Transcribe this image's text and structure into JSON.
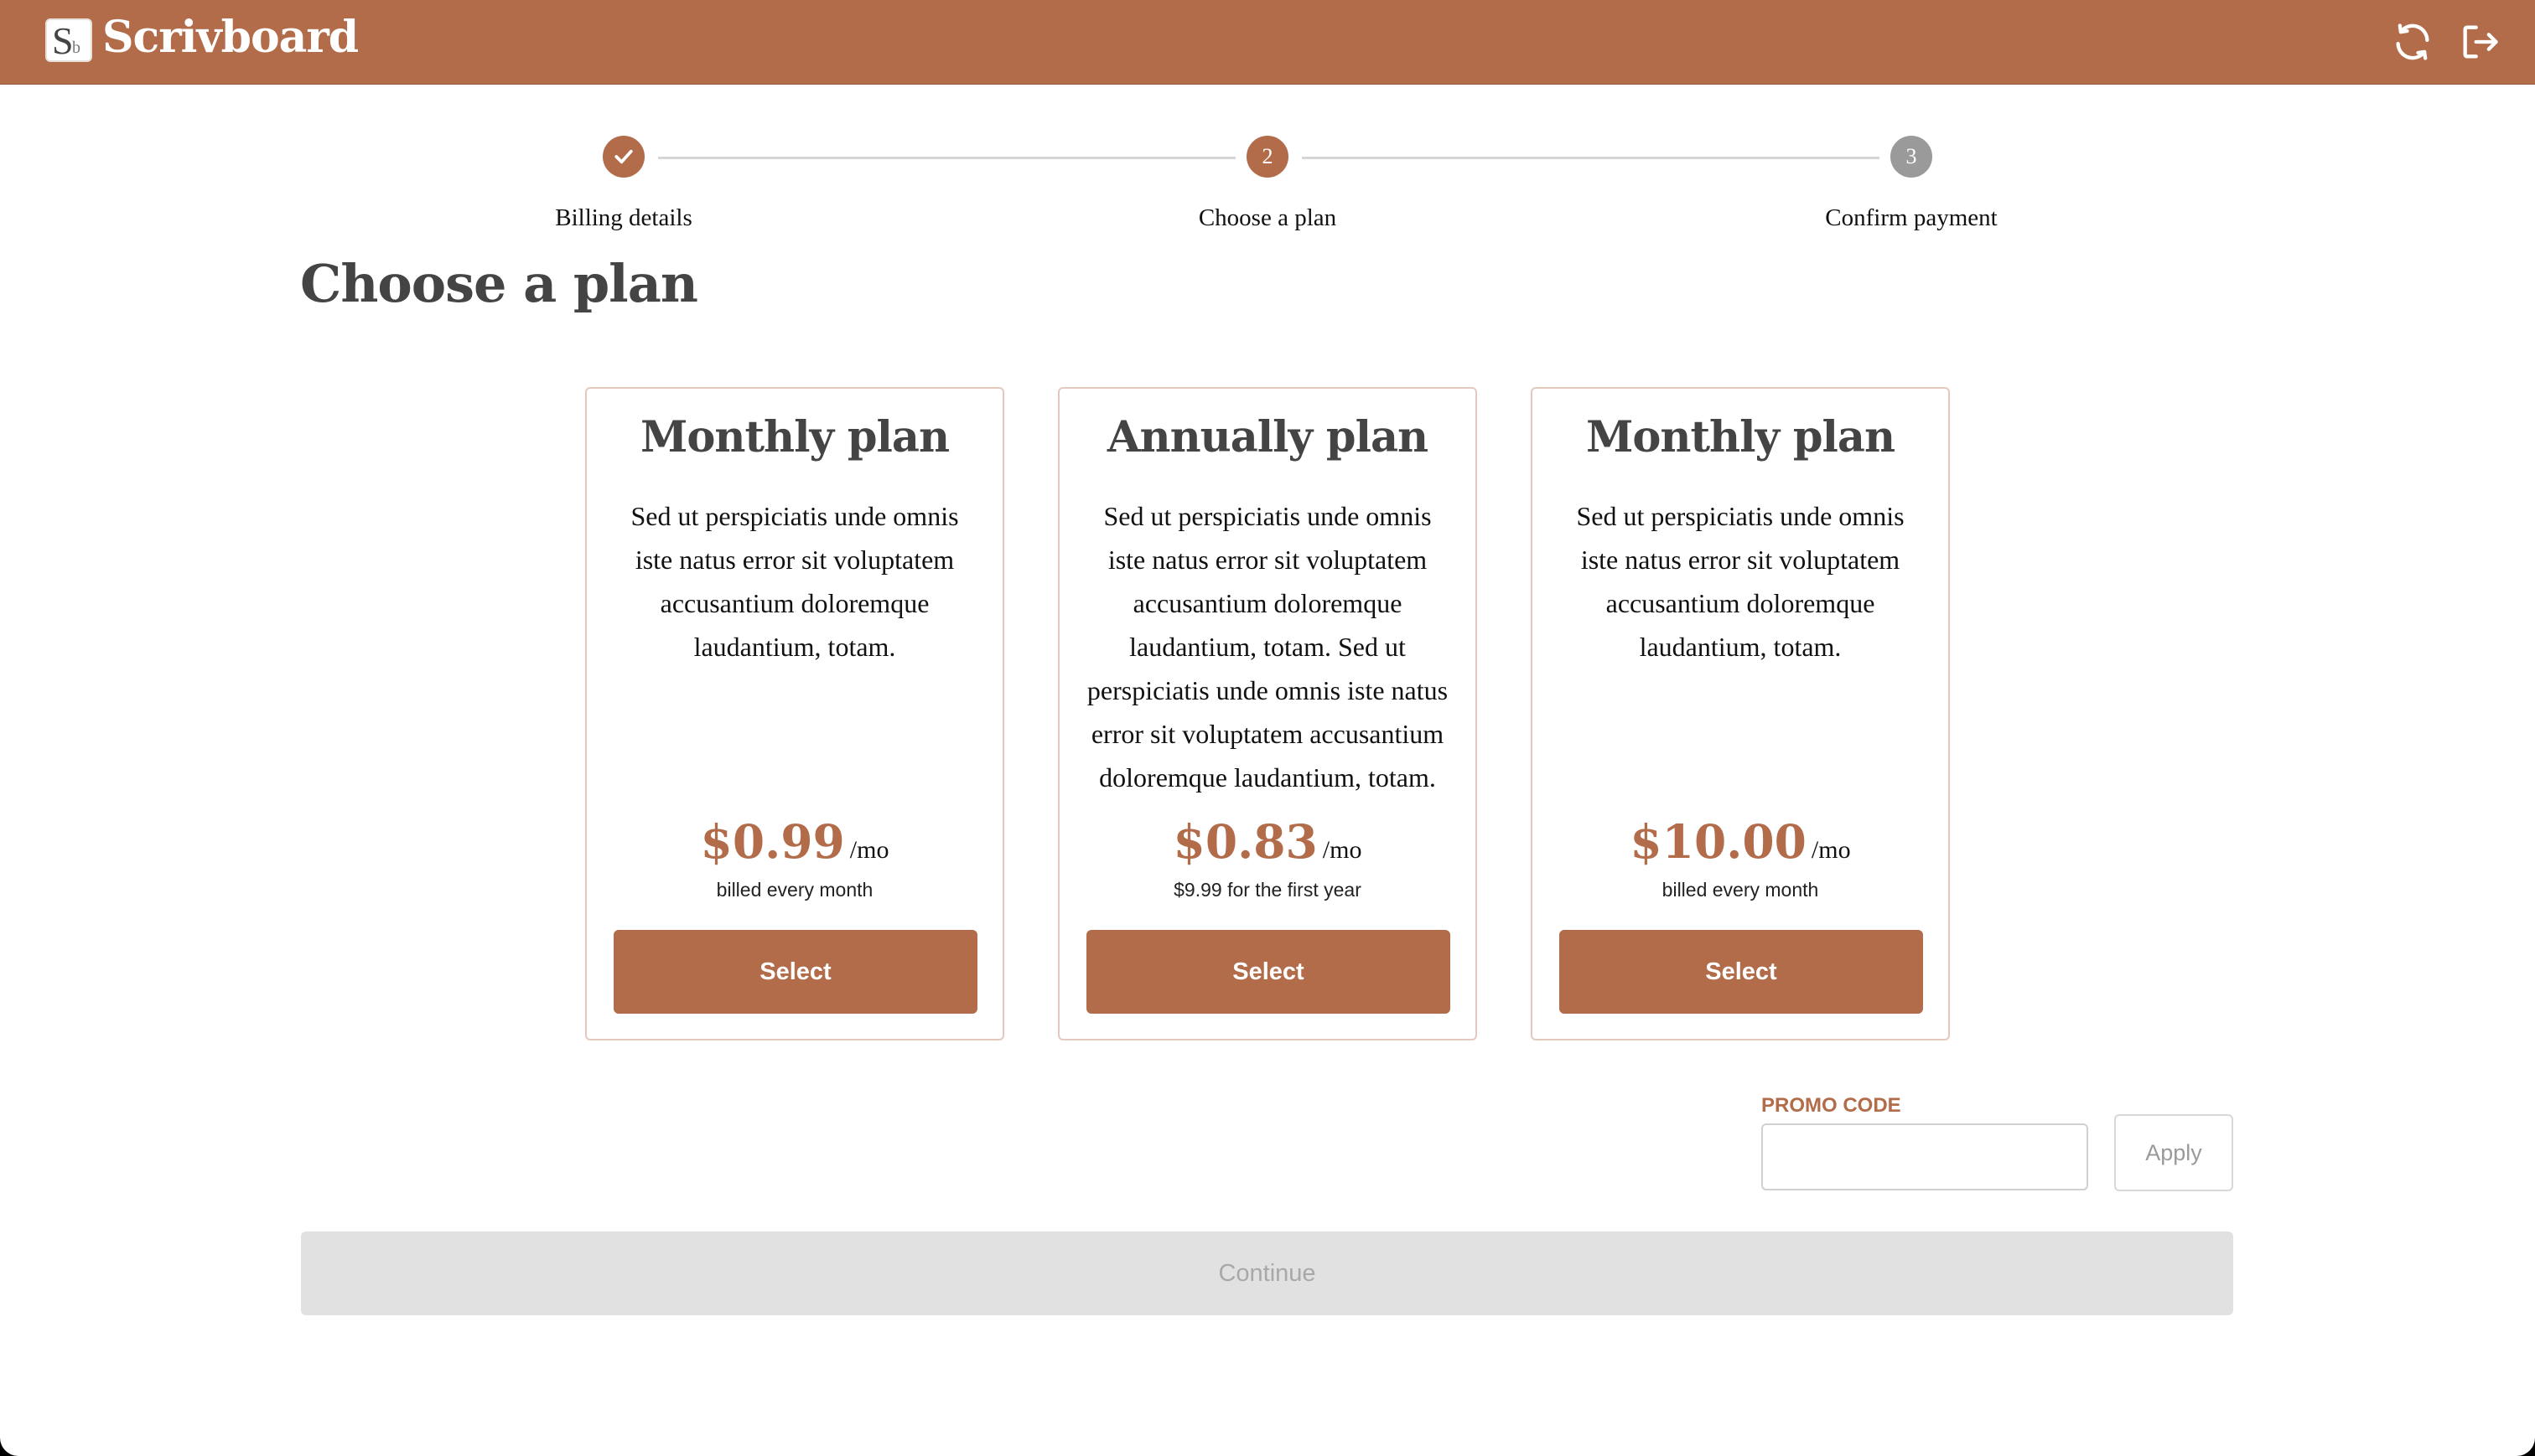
{
  "header": {
    "app_name": "Scrivboard",
    "logo_letter_main": "S",
    "logo_letter_sub": "b",
    "refresh_icon": "refresh-icon",
    "logout_icon": "logout-icon",
    "background": "#b26c4a"
  },
  "stepper": {
    "steps": [
      {
        "label": "Billing details",
        "number": "1",
        "state": "completed"
      },
      {
        "label": "Choose a plan",
        "number": "2",
        "state": "active"
      },
      {
        "label": "Confirm payment",
        "number": "3",
        "state": "pending"
      }
    ],
    "active_color": "#b26c4a",
    "pending_color": "#9a9a9a"
  },
  "page_title": "Choose a plan",
  "plans": [
    {
      "title": "Monthly plan",
      "description": "Sed ut perspiciatis unde omnis iste natus error sit voluptatem accusantium doloremque laudantium, totam.",
      "price": "$0.99",
      "period": "/mo",
      "billing_note": "billed every month",
      "button_label": "Select"
    },
    {
      "title": "Annually plan",
      "description": "Sed ut perspiciatis unde omnis iste natus error sit voluptatem accusantium doloremque laudantium, totam. Sed ut perspiciatis unde omnis iste natus error sit voluptatem accusantium doloremque laudantium, totam.",
      "price": "$0.83",
      "period": "/mo",
      "billing_note": "$9.99 for the first year",
      "button_label": "Select"
    },
    {
      "title": "Monthly plan",
      "description": "Sed ut perspiciatis unde omnis iste natus error sit voluptatem accusantium doloremque laudantium, totam.",
      "price": "$10.00",
      "period": "/mo",
      "billing_note": "billed every month",
      "button_label": "Select"
    }
  ],
  "promo": {
    "label": "PROMO CODE",
    "value": "",
    "apply_label": "Apply"
  },
  "continue_label": "Continue",
  "accent_color": "#b26c4a"
}
